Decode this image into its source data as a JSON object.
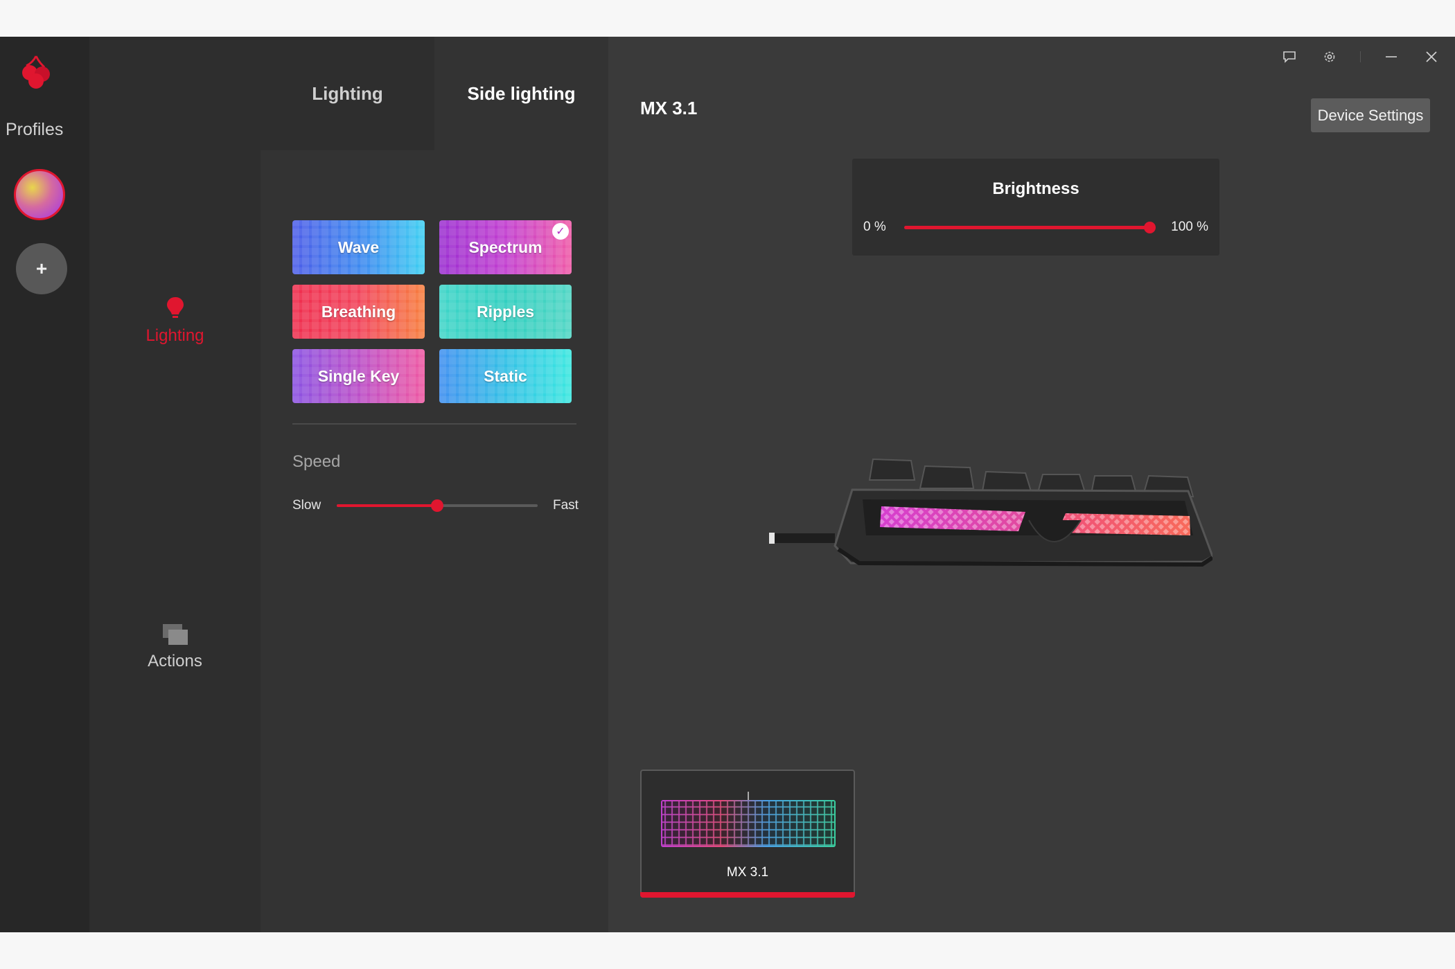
{
  "rail": {
    "profiles_label": "Profiles",
    "add_label": "+"
  },
  "nav": {
    "lighting_label": "Lighting",
    "actions_label": "Actions"
  },
  "tabs": {
    "lighting": "Lighting",
    "side_lighting": "Side lighting"
  },
  "effects": [
    {
      "label": "Wave"
    },
    {
      "label": "Spectrum",
      "selected": true
    },
    {
      "label": "Breathing"
    },
    {
      "label": "Ripples"
    },
    {
      "label": "Single Key"
    },
    {
      "label": "Static"
    }
  ],
  "speed": {
    "label": "Speed",
    "min_label": "Slow",
    "max_label": "Fast",
    "value_fraction": 0.5
  },
  "main": {
    "device_title": "MX 3.1",
    "device_settings_label": "Device Settings"
  },
  "brightness": {
    "title": "Brightness",
    "min_label": "0 %",
    "max_label": "100 %",
    "value_fraction": 1.0
  },
  "device_card": {
    "label": "MX 3.1"
  },
  "colors": {
    "accent": "#e0162f",
    "background": "#363636"
  },
  "icons": {
    "logo": "cherry-logo-icon",
    "lighting": "bulb-icon",
    "actions": "actions-icon",
    "feedback": "chat-icon",
    "settings": "gear-icon",
    "minimize": "minimize-icon",
    "close": "close-icon"
  }
}
